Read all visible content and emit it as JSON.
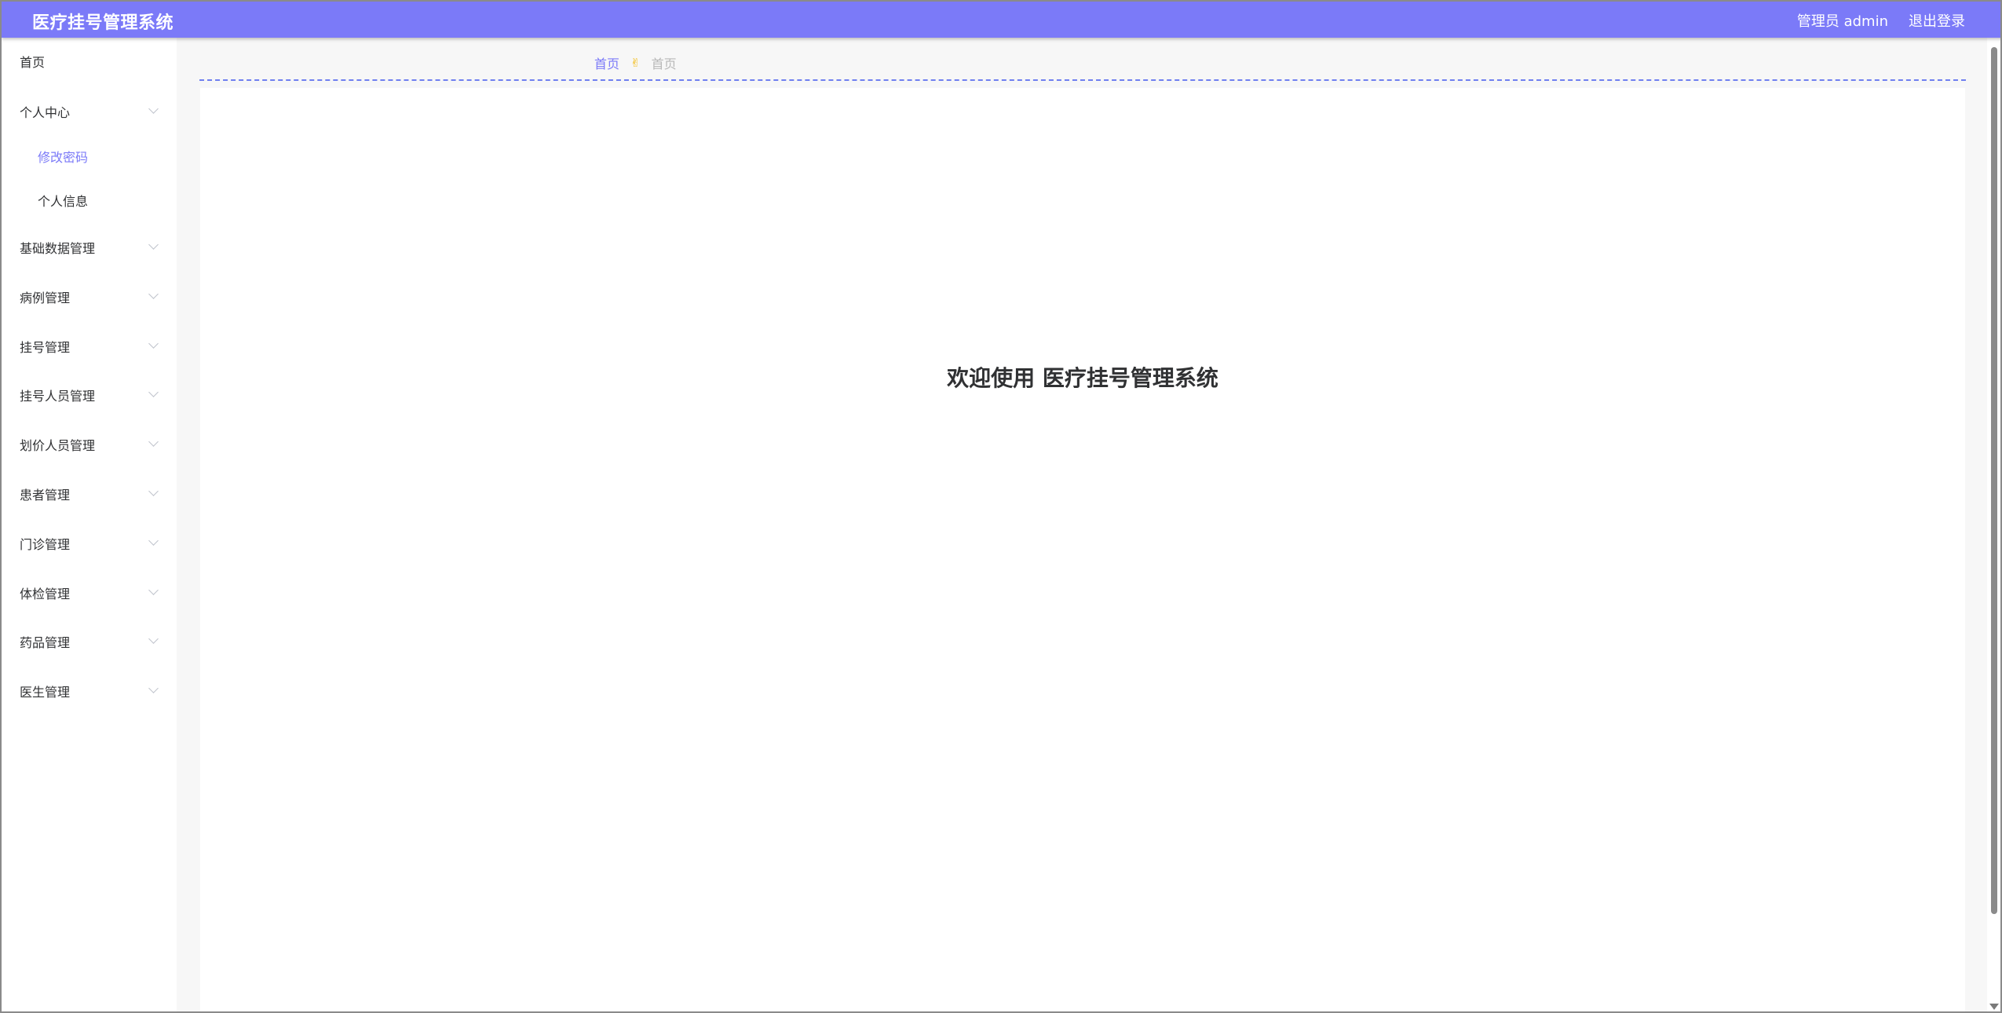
{
  "header": {
    "title": "医疗挂号管理系统",
    "user_label": "管理员 admin",
    "logout_label": "退出登录"
  },
  "sidebar": {
    "items": [
      {
        "label": "首页",
        "expandable": false
      },
      {
        "label": "个人中心",
        "expandable": true
      },
      {
        "label": "修改密码",
        "sub": true,
        "active": true
      },
      {
        "label": "个人信息",
        "sub": true
      },
      {
        "label": "基础数据管理",
        "expandable": true
      },
      {
        "label": "病例管理",
        "expandable": true
      },
      {
        "label": "挂号管理",
        "expandable": true
      },
      {
        "label": "挂号人员管理",
        "expandable": true
      },
      {
        "label": "划价人员管理",
        "expandable": true
      },
      {
        "label": "患者管理",
        "expandable": true
      },
      {
        "label": "门诊管理",
        "expandable": true
      },
      {
        "label": "体检管理",
        "expandable": true
      },
      {
        "label": "药品管理",
        "expandable": true
      },
      {
        "label": "医生管理",
        "expandable": true
      }
    ]
  },
  "breadcrumb": {
    "home": "首页",
    "separator_icon": "hand-icon",
    "current": "首页"
  },
  "main": {
    "welcome_text": "欢迎使用 医疗挂号管理系统"
  },
  "colors": {
    "accent": "#7B7AF8",
    "dashed_line": "#6f7ff0",
    "breadcrumb_separator": "#f2b600"
  }
}
